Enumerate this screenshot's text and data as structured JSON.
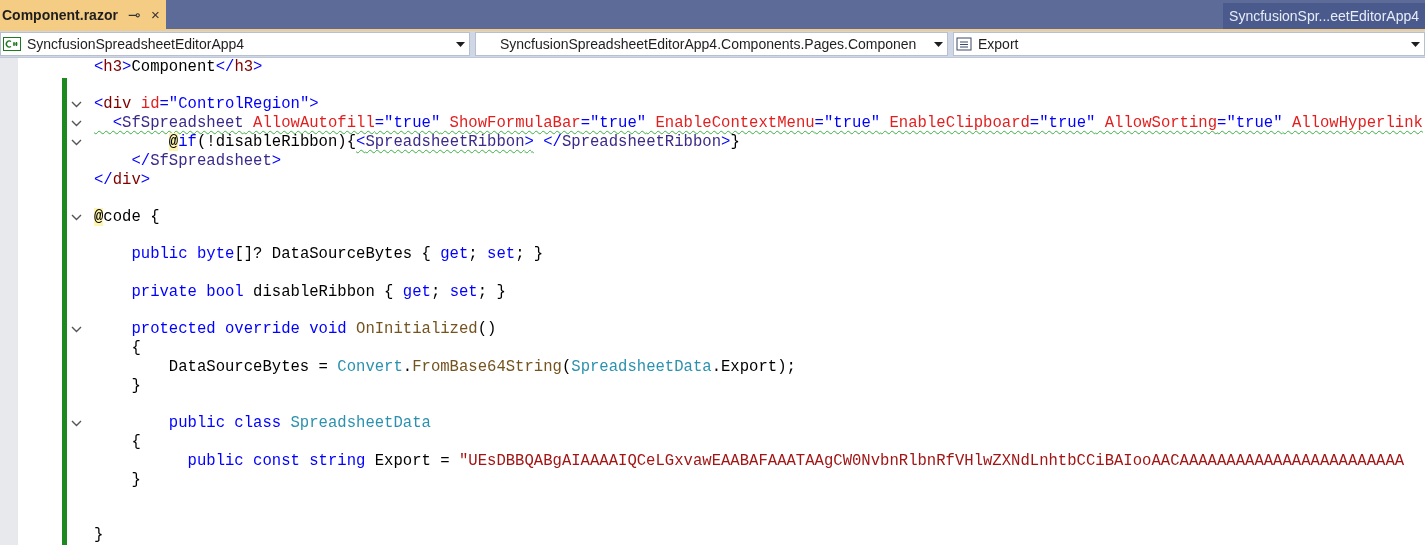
{
  "tabs": [
    {
      "label": "Component.razor",
      "selected": true,
      "pin": "⊸",
      "close": "×"
    }
  ],
  "solution_tab": {
    "label": "SyncfusionSpr...eetEditorApp4"
  },
  "nav_bar": [
    {
      "kind": "project",
      "text": "SyncfusionSpreadsheetEditorApp4"
    },
    {
      "kind": "type",
      "text": "SyncfusionSpreadsheetEditorApp4.Components.Pages.Componen"
    },
    {
      "kind": "member",
      "text": "Export"
    }
  ],
  "code_lines": [
    {
      "foldable": false,
      "segments": [
        {
          "text": "<",
          "kind": "keyword"
        },
        {
          "text": "h3",
          "kind": "tag"
        },
        {
          "text": ">",
          "kind": "keyword"
        },
        {
          "text": "Component",
          "kind": "plain"
        },
        {
          "text": "</",
          "kind": "keyword"
        },
        {
          "text": "h3",
          "kind": "tag"
        },
        {
          "text": ">",
          "kind": "keyword"
        }
      ]
    },
    {
      "foldable": false
    },
    {
      "foldable": true,
      "segments": [
        {
          "text": "<",
          "kind": "keyword"
        },
        {
          "text": "div",
          "kind": "tag"
        },
        {
          "text": " id",
          "kind": "attribute"
        },
        {
          "text": "=\"ControlRegion\">",
          "kind": "keyword"
        }
      ]
    },
    {
      "foldable": true,
      "segments": [
        {
          "text": "  <",
          "kind": "keyword",
          "warning": true
        },
        {
          "text": "SfSpreadsheet",
          "kind": "component",
          "warning": true
        },
        {
          "text": " AllowAutofill",
          "kind": "attribute",
          "warning": true
        },
        {
          "text": "=\"true\"",
          "kind": "keyword",
          "warning": true
        },
        {
          "text": " ShowFormulaBar",
          "kind": "attribute",
          "warning": true
        },
        {
          "text": "=\"true\"",
          "kind": "keyword",
          "warning": true
        },
        {
          "text": " EnableContextMenu",
          "kind": "attribute",
          "warning": true
        },
        {
          "text": "=\"true\"",
          "kind": "keyword",
          "warning": true
        },
        {
          "text": " EnableClipboard",
          "kind": "attribute",
          "warning": true
        },
        {
          "text": "=\"true\"",
          "kind": "keyword",
          "warning": true
        },
        {
          "text": " AllowSorting",
          "kind": "attribute",
          "warning": true
        },
        {
          "text": "=\"true\"",
          "kind": "keyword",
          "warning": true
        },
        {
          "text": " AllowHyperlink",
          "kind": "attribute",
          "warning": true
        }
      ]
    },
    {
      "foldable": true,
      "segments": [
        {
          "text": "        @",
          "kind": "plain",
          "highlight": true,
          "warning": false
        },
        {
          "text": "if",
          "kind": "keyword",
          "highlight": false,
          "warning": false
        },
        {
          "text": "(!disableRibbon){",
          "kind": "plain",
          "highlight": false,
          "warning": false
        },
        {
          "text": "<",
          "kind": "keyword",
          "highlight": false,
          "warning": true
        },
        {
          "text": "SpreadsheetRibbon",
          "kind": "component",
          "highlight": false,
          "warning": true
        },
        {
          "text": ">",
          "kind": "keyword",
          "highlight": false,
          "warning": true
        },
        {
          "text": " </",
          "kind": "keyword",
          "highlight": false,
          "warning": false
        },
        {
          "text": "SpreadsheetRibbon",
          "kind": "component",
          "highlight": false,
          "warning": false
        },
        {
          "text": ">",
          "kind": "keyword",
          "highlight": false,
          "warning": false
        },
        {
          "text": "}",
          "kind": "plain",
          "highlight": false,
          "warning": false
        }
      ]
    },
    {
      "foldable": false,
      "segments": [
        {
          "text": "    </",
          "kind": "keyword"
        },
        {
          "text": "SfSpreadsheet",
          "kind": "component"
        },
        {
          "text": ">",
          "kind": "keyword"
        }
      ]
    },
    {
      "foldable": false,
      "segments": [
        {
          "text": "</",
          "kind": "keyword"
        },
        {
          "text": "div",
          "kind": "tag"
        },
        {
          "text": ">",
          "kind": "keyword"
        }
      ]
    },
    {
      "foldable": false
    },
    {
      "foldable": true,
      "segments": [
        {
          "text": "@",
          "kind": "plain",
          "highlight": true
        },
        {
          "text": "code {",
          "kind": "plain",
          "highlight": false
        }
      ]
    },
    {
      "foldable": false
    },
    {
      "foldable": false,
      "segments": [
        {
          "text": "    public byte",
          "kind": "keyword"
        },
        {
          "text": "[]? DataSourceBytes { ",
          "kind": "plain"
        },
        {
          "text": "get",
          "kind": "keyword"
        },
        {
          "text": "; ",
          "kind": "plain"
        },
        {
          "text": "set",
          "kind": "keyword"
        },
        {
          "text": "; }",
          "kind": "plain"
        }
      ]
    },
    {
      "foldable": false
    },
    {
      "foldable": false,
      "segments": [
        {
          "text": "    private bool",
          "kind": "keyword"
        },
        {
          "text": " disableRibbon { ",
          "kind": "plain"
        },
        {
          "text": "get",
          "kind": "keyword"
        },
        {
          "text": "; ",
          "kind": "plain"
        },
        {
          "text": "set",
          "kind": "keyword"
        },
        {
          "text": "; }",
          "kind": "plain"
        }
      ]
    },
    {
      "foldable": false
    },
    {
      "foldable": true,
      "segments": [
        {
          "text": "    protected override void",
          "kind": "keyword"
        },
        {
          "text": " OnInitialized",
          "kind": "method"
        },
        {
          "text": "()",
          "kind": "plain"
        }
      ]
    },
    {
      "foldable": false,
      "segments": [
        {
          "text": "    {",
          "kind": "plain"
        }
      ]
    },
    {
      "foldable": false,
      "segments": [
        {
          "text": "        DataSourceBytes = ",
          "kind": "plain"
        },
        {
          "text": "Convert",
          "kind": "type"
        },
        {
          "text": ".",
          "kind": "plain"
        },
        {
          "text": "FromBase64String",
          "kind": "method"
        },
        {
          "text": "(",
          "kind": "plain"
        },
        {
          "text": "SpreadsheetData",
          "kind": "type"
        },
        {
          "text": ".Export);",
          "kind": "plain"
        }
      ]
    },
    {
      "foldable": false,
      "segments": [
        {
          "text": "    }",
          "kind": "plain"
        }
      ]
    },
    {
      "foldable": false
    },
    {
      "foldable": true,
      "segments": [
        {
          "text": "        public class",
          "kind": "keyword"
        },
        {
          "text": " SpreadsheetData",
          "kind": "type"
        }
      ]
    },
    {
      "foldable": false,
      "segments": [
        {
          "text": "    {",
          "kind": "plain"
        }
      ]
    },
    {
      "foldable": false,
      "segments": [
        {
          "text": "          public const string",
          "kind": "keyword"
        },
        {
          "text": " Export = ",
          "kind": "plain"
        },
        {
          "text": "\"UEsDBBQABgAIAAAAIQCeLGxvawEAABAFAAATAAgCW0NvbnRlbnRfVHlwZXNdLnhtbCCiBAIooAACAAAAAAAAAAAAAAAAAAAAAAAA",
          "kind": "string"
        }
      ]
    },
    {
      "foldable": false,
      "segments": [
        {
          "text": "    }",
          "kind": "plain"
        }
      ]
    },
    {
      "foldable": false
    },
    {
      "foldable": false
    },
    {
      "foldable": false,
      "segments": [
        {
          "text": "}",
          "kind": "plain"
        }
      ]
    }
  ]
}
